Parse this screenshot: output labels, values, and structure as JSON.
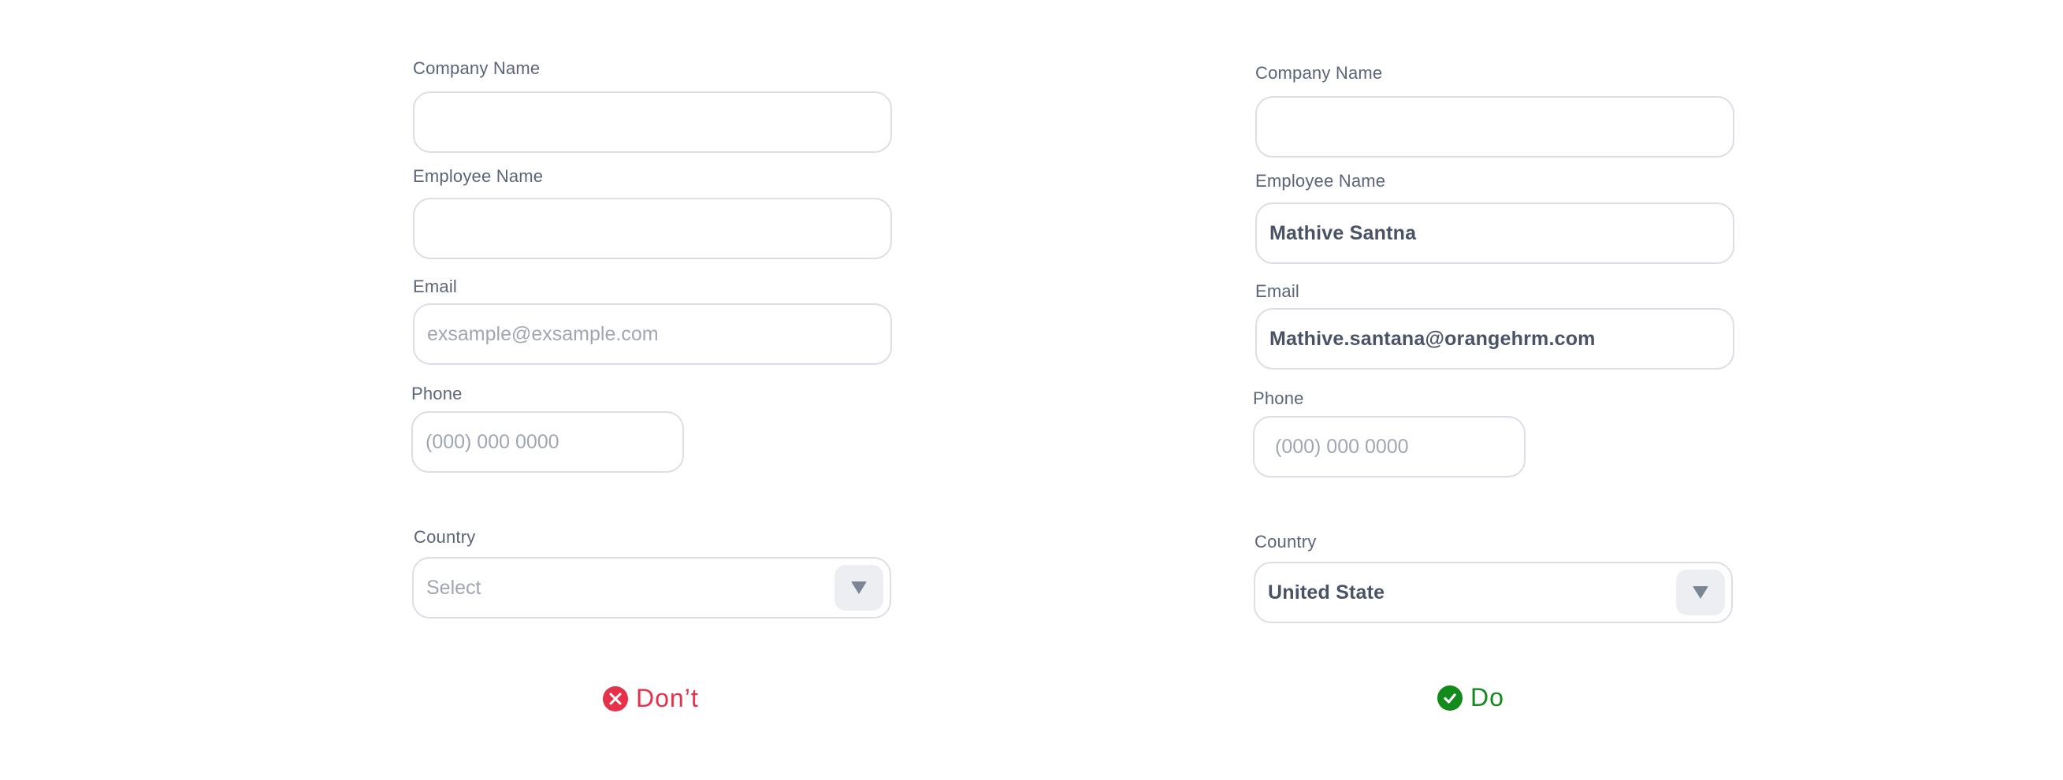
{
  "colors": {
    "dont": "#e5324a",
    "do": "#128a1c",
    "label": "#5b6478",
    "placeholder": "#a1a6b3",
    "value": "#4a5268",
    "border": "#dcdee6"
  },
  "dont_form": {
    "company_label": "Company Name",
    "company_value": "",
    "employee_label": "Employee Name",
    "employee_value": "",
    "email_label": "Email",
    "email_placeholder": "exsample@exsample.com",
    "phone_label": "Phone",
    "phone_placeholder": "(000) 000 0000",
    "country_label": "Country",
    "country_placeholder": "Select",
    "verdict_label": "Don’t",
    "verdict_icon": "x-circle-icon"
  },
  "do_form": {
    "company_label": "Company Name",
    "company_value": "",
    "employee_label": "Employee Name",
    "employee_value": "Mathive Santna",
    "email_label": "Email",
    "email_value": "Mathive.santana@orangehrm.com",
    "phone_label": "Phone",
    "phone_placeholder": "(000) 000 0000",
    "country_label": "Country",
    "country_value": "United State",
    "verdict_label": "Do",
    "verdict_icon": "check-circle-icon"
  }
}
